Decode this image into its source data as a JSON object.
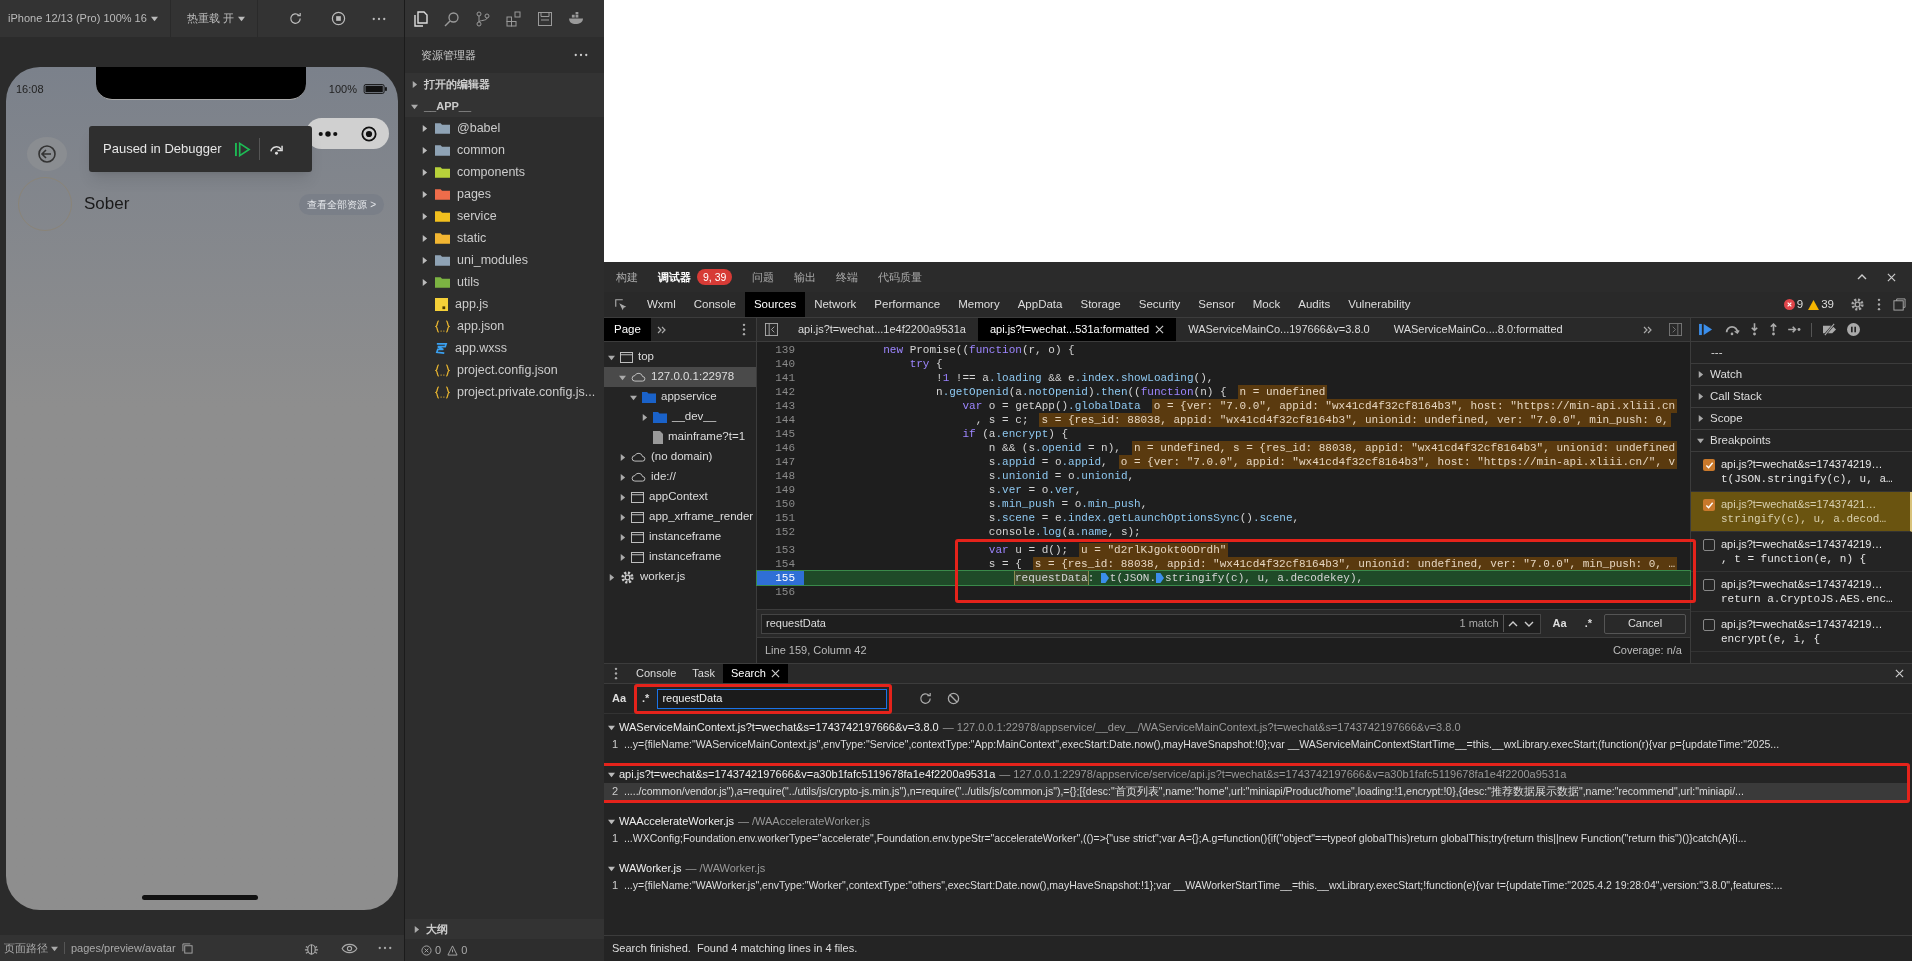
{
  "simulator": {
    "device": "iPhone 12/13 (Pro) 100% 16",
    "hot_reload": "热重载 开",
    "phone": {
      "time": "16:08",
      "battery": "100%",
      "overlay": "Paused in Debugger",
      "profile_name": "Sober",
      "resources_button": "查看全部资源 >"
    },
    "page_path_label": "页面路径",
    "page_path": "pages/preview/avatar"
  },
  "explorer": {
    "title": "资源管理器",
    "sections": [
      {
        "label": "打开的编辑器",
        "expanded": false
      },
      {
        "label": "__APP__",
        "expanded": true,
        "children": [
          {
            "label": "@babel",
            "kind": "folder",
            "color": "#8fa3b5",
            "expanded": false
          },
          {
            "label": "common",
            "kind": "folder",
            "color": "#8fa3b5",
            "expanded": false
          },
          {
            "label": "components",
            "kind": "folder",
            "color": "#b7d13a",
            "expanded": false
          },
          {
            "label": "pages",
            "kind": "folder",
            "color": "#ef6c4a",
            "expanded": false
          },
          {
            "label": "service",
            "kind": "folder",
            "color": "#f2c01e",
            "expanded": false
          },
          {
            "label": "static",
            "kind": "folder",
            "color": "#f2b632",
            "expanded": false
          },
          {
            "label": "uni_modules",
            "kind": "folder",
            "color": "#8fa3b5",
            "expanded": false
          },
          {
            "label": "utils",
            "kind": "folder",
            "color": "#7cb342",
            "expanded": false
          },
          {
            "label": "app.js",
            "kind": "js"
          },
          {
            "label": "app.json",
            "kind": "json"
          },
          {
            "label": "app.wxss",
            "kind": "css"
          },
          {
            "label": "project.config.json",
            "kind": "json"
          },
          {
            "label": "project.private.config.js...",
            "kind": "json"
          }
        ]
      }
    ],
    "outline": {
      "label": "大纲",
      "expanded": false
    },
    "errors": "0",
    "warnings": "0"
  },
  "devtools": {
    "top_tabs": [
      {
        "label": "构建",
        "selected": false
      },
      {
        "label": "调试器",
        "selected": true,
        "badge": "9, 39"
      },
      {
        "label": "问题",
        "selected": false
      },
      {
        "label": "输出",
        "selected": false
      },
      {
        "label": "终端",
        "selected": false
      },
      {
        "label": "代码质量",
        "selected": false
      }
    ],
    "panel_tabs": [
      {
        "label": "Wxml",
        "selected": false
      },
      {
        "label": "Console",
        "selected": false
      },
      {
        "label": "Sources",
        "selected": true
      },
      {
        "label": "Network",
        "selected": false
      },
      {
        "label": "Performance",
        "selected": false
      },
      {
        "label": "Memory",
        "selected": false
      },
      {
        "label": "AppData",
        "selected": false
      },
      {
        "label": "Storage",
        "selected": false
      },
      {
        "label": "Security",
        "selected": false
      },
      {
        "label": "Sensor",
        "selected": false
      },
      {
        "label": "Mock",
        "selected": false
      },
      {
        "label": "Audits",
        "selected": false
      },
      {
        "label": "Vulnerability",
        "selected": false
      }
    ],
    "error_count": "9",
    "warning_count": "39",
    "navigator_tab": "Page",
    "tree": [
      {
        "label": "top",
        "kind": "frame",
        "expanded": true,
        "selected": false,
        "children": [
          {
            "label": "127.0.0.1:22978",
            "kind": "cloud",
            "expanded": true,
            "selected": true,
            "children": [
              {
                "label": "appservice",
                "kind": "folder",
                "expanded": true,
                "selected": false,
                "children": [
                  {
                    "label": "__dev__",
                    "kind": "folder",
                    "expanded": false,
                    "selected": false
                  },
                  {
                    "label": "mainframe?t=1",
                    "kind": "file",
                    "selected": false
                  }
                ]
              }
            ]
          },
          {
            "label": "(no domain)",
            "kind": "cloud",
            "expanded": false,
            "selected": false
          },
          {
            "label": "ide://",
            "kind": "cloud",
            "expanded": false,
            "selected": false
          },
          {
            "label": "appContext",
            "kind": "frame",
            "expanded": false,
            "selected": false
          },
          {
            "label": "app_xrframe_render",
            "kind": "frame",
            "expanded": false,
            "selected": false
          },
          {
            "label": "instanceframe",
            "kind": "frame",
            "expanded": false,
            "selected": false
          },
          {
            "label": "instanceframe",
            "kind": "frame",
            "expanded": false,
            "selected": false
          }
        ]
      },
      {
        "label": "worker.js",
        "kind": "gear",
        "expanded": false,
        "selected": false
      }
    ],
    "file_tabs": [
      {
        "label": "api.js?t=wechat...1e4f2200a9531a",
        "selected": false
      },
      {
        "label": "api.js?t=wechat...531a:formatted",
        "selected": true
      },
      {
        "label": "WAServiceMainCo...197666&v=3.8.0",
        "selected": false
      },
      {
        "label": "WAServiceMainCo....8.0:formatted",
        "selected": false
      }
    ],
    "code": [
      {
        "number": "139",
        "code": "            new Promise((function(r, o) {",
        "paused": false,
        "boxed": false
      },
      {
        "number": "140",
        "code": "                try {",
        "paused": false,
        "boxed": false
      },
      {
        "number": "141",
        "code": "                    !1 !== a.loading && e.index.showLoading(),",
        "paused": false,
        "boxed": false
      },
      {
        "number": "142",
        "code": "                    n.getOpenid(a.notOpenid).then((function(n) {",
        "inline": "n = undefined",
        "paused": false,
        "boxed": false
      },
      {
        "number": "143",
        "code": "                        var o = getApp().globalData",
        "inline": "o = {ver: \"7.0.0\", appid: \"wx41cd4f32cf8164b3\", host: \"https://min-api.xliii.cn",
        "paused": false,
        "boxed": false
      },
      {
        "number": "144",
        "code": "                          , s = c;",
        "inline": "s = {res_id: 88038, appid: \"wx41cd4f32cf8164b3\", unionid: undefined, ver: \"7.0.0\", min_push: 0,",
        "paused": false,
        "boxed": false
      },
      {
        "number": "145",
        "code": "                        if (a.encrypt) {",
        "paused": false,
        "boxed": false
      },
      {
        "number": "146",
        "code": "                            n && (s.openid = n),",
        "inline": "n = undefined, s = {res_id: 88038, appid: \"wx41cd4f32cf8164b3\", unionid: undefined",
        "paused": false,
        "boxed": false
      },
      {
        "number": "147",
        "code": "                            s.appid = o.appid,",
        "inline": "o = {ver: \"7.0.0\", appid: \"wx41cd4f32cf8164b3\", host: \"https://min-api.xliii.cn/\", v",
        "paused": false,
        "boxed": false
      },
      {
        "number": "148",
        "code": "                            s.unionid = o.unionid,",
        "paused": false,
        "boxed": false
      },
      {
        "number": "149",
        "code": "                            s.ver = o.ver,",
        "paused": false,
        "boxed": false
      },
      {
        "number": "150",
        "code": "                            s.min_push = o.min_push,",
        "paused": false,
        "boxed": false
      },
      {
        "number": "151",
        "code": "                            s.scene = e.index.getLaunchOptionsSync().scene,",
        "paused": false,
        "boxed": false
      },
      {
        "number": "152",
        "code": "                            console.log(a.name, s);",
        "paused": false,
        "boxed": false
      },
      {
        "number": "153",
        "code": "                            var u = d();",
        "inline": "u = \"d2rlKJgokt0ODrdh\"",
        "paused": false,
        "boxed": true
      },
      {
        "number": "154",
        "code": "                            s = {",
        "inline": "s = {res_id: 88038, appid: \"wx41cd4f32cf8164b3\", unionid: undefined, ver: \"7.0.0\", min_push: 0, …",
        "paused": false,
        "boxed": true
      },
      {
        "number": "155",
        "paused": true,
        "boxed": true,
        "parts": [
          {
            "text": "requestData",
            "kind": "match"
          },
          {
            "text": ": ",
            "kind": "plain"
          },
          {
            "text": "t(JSON.",
            "kind": "marked"
          },
          {
            "text": "stringify(c), u, a.decodekey),",
            "kind": "marked"
          }
        ]
      },
      {
        "number": "156",
        "paused": false,
        "boxed": true
      }
    ],
    "find": {
      "value": "requestData",
      "count": "1 match",
      "case_toggle": "Aa",
      "regex_toggle": ".*",
      "cancel": "Cancel"
    },
    "position": "Line 159, Column 42",
    "coverage": "Coverage: n/a",
    "sidebar": {
      "thread": "---",
      "sections": [
        {
          "label": "Watch",
          "expanded": false
        },
        {
          "label": "Call Stack",
          "expanded": false
        },
        {
          "label": "Scope",
          "expanded": false
        },
        {
          "label": "Breakpoints",
          "expanded": true
        }
      ],
      "breakpoints": [
        {
          "file": "api.js?t=wechat&s=174374219…",
          "snippet": "t(JSON.stringify(c), u, a…",
          "checked": true,
          "selected": false
        },
        {
          "file": "api.js?t=wechat&s=17437421…",
          "snippet": "stringify(c), u, a.decod…",
          "checked": true,
          "selected": true
        },
        {
          "file": "api.js?t=wechat&s=174374219…",
          "snippet": ", t = function(e, n) {",
          "checked": false,
          "selected": false
        },
        {
          "file": "api.js?t=wechat&s=174374219…",
          "snippet": "return a.CryptoJS.AES.enc…",
          "checked": false,
          "selected": false
        },
        {
          "file": "api.js?t=wechat&s=174374219…",
          "snippet": "encrypt(e, i, {",
          "checked": false,
          "selected": false
        }
      ]
    },
    "drawer": {
      "tabs": [
        {
          "label": "Console",
          "selected": false
        },
        {
          "label": "Task",
          "selected": false
        },
        {
          "label": "Search",
          "selected": true
        }
      ],
      "case_toggle": "Aa",
      "regex_toggle": ".*",
      "query": "requestData",
      "query_boxed": true,
      "results": [
        {
          "file": "WAServiceMainContext.js?t=wechat&s=1743742197666&v=3.8.0",
          "path": "— 127.0.0.1:22978/appservice/__dev__/WAServiceMainContext.js?t=wechat&s=1743742197666&v=3.8.0",
          "boxed": false,
          "matches": [
            {
              "line": "1",
              "text": "...y={fileName:\"WAServiceMainContext.js\",envType:\"Service\",contextType:\"App:MainContext\",execStart:Date.now(),mayHaveSnapshot:!0};var __WAServiceMainContextStartTime__=this.__wxLibrary.execStart;(function(r){var p={updateTime:\"2025...",
              "selected": false
            }
          ]
        },
        {
          "file": "api.js?t=wechat&s=1743742197666&v=a30b1fafc5119678fa1e4f2200a9531a",
          "path": "— 127.0.0.1:22978/appservice/service/api.js?t=wechat&s=1743742197666&v=a30b1fafc5119678fa1e4f2200a9531a",
          "boxed": true,
          "matches": [
            {
              "line": "2",
              "text": "...../common/vendor.js\"),a=require(\"../utils/js/crypto-js.min.js\"),n=require(\"../utils/js/common.js\"),={};[{desc:\"首页列表\",name:\"home\",url:\"miniapi/Product/home\",loading:!1,encrypt:!0},{desc:\"推荐数据展示数据\",name:\"recommend\",url:\"miniapi/...",
              "selected": true
            }
          ]
        },
        {
          "file": "WAAccelerateWorker.js",
          "path": "— /WAAccelerateWorker.js",
          "boxed": false,
          "matches": [
            {
              "line": "1",
              "text": "...WXConfig;Foundation.env.workerType=\"accelerate\",Foundation.env.typeStr=\"accelerateWorker\",(()=>{\"use strict\";var A={};A.g=function(){if(\"object\"==typeof globalThis)return globalThis;try{return this||new Function(\"return this\")()}catch(A){i...",
              "selected": false
            }
          ]
        },
        {
          "file": "WAWorker.js",
          "path": "— /WAWorker.js",
          "boxed": false,
          "matches": [
            {
              "line": "1",
              "text": "...y={fileName:\"WAWorker.js\",envType:\"Worker\",contextType:\"others\",execStart:Date.now(),mayHaveSnapshot:!1};var __WAWorkerStartTime__=this.__wxLibrary.execStart;!function(e){var t={updateTime:\"2025.4.2 19:28:04\",version:\"3.8.0\",features:...",
              "selected": false
            }
          ]
        }
      ],
      "status": "Search finished.  Found 4 matching lines in 4 files."
    }
  }
}
